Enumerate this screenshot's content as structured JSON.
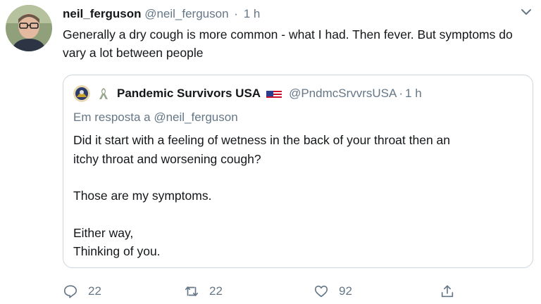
{
  "tweet": {
    "display_name": "neil_ferguson",
    "handle": "@neil_ferguson",
    "separator": "·",
    "time": "1 h",
    "text": "Generally a dry cough is more common - what I had. Then fever. But symptoms do vary a lot between people",
    "avatar_icon": "user-avatar"
  },
  "quoted_tweet": {
    "display_name": "Pandemic Survivors USA",
    "handle": "@PndmcSrvvrsUSA",
    "separator": "·",
    "time": "1 h",
    "reply_to": "Em resposta a @neil_ferguson",
    "lines": [
      "Did it start with a feeling of wetness in the back of your throat then an",
      "itchy throat and worsening cough?",
      "Those are my symptoms.",
      "Either way,",
      "Thinking of you."
    ],
    "icons": [
      "quoted-avatar",
      "ribbon-emoji-icon",
      "us-flag-icon"
    ]
  },
  "actions": {
    "replies": "22",
    "retweets": "22",
    "likes": "92"
  },
  "colors": {
    "text": "#14171a",
    "secondary": "#657786",
    "border": "#ccd6dd"
  }
}
